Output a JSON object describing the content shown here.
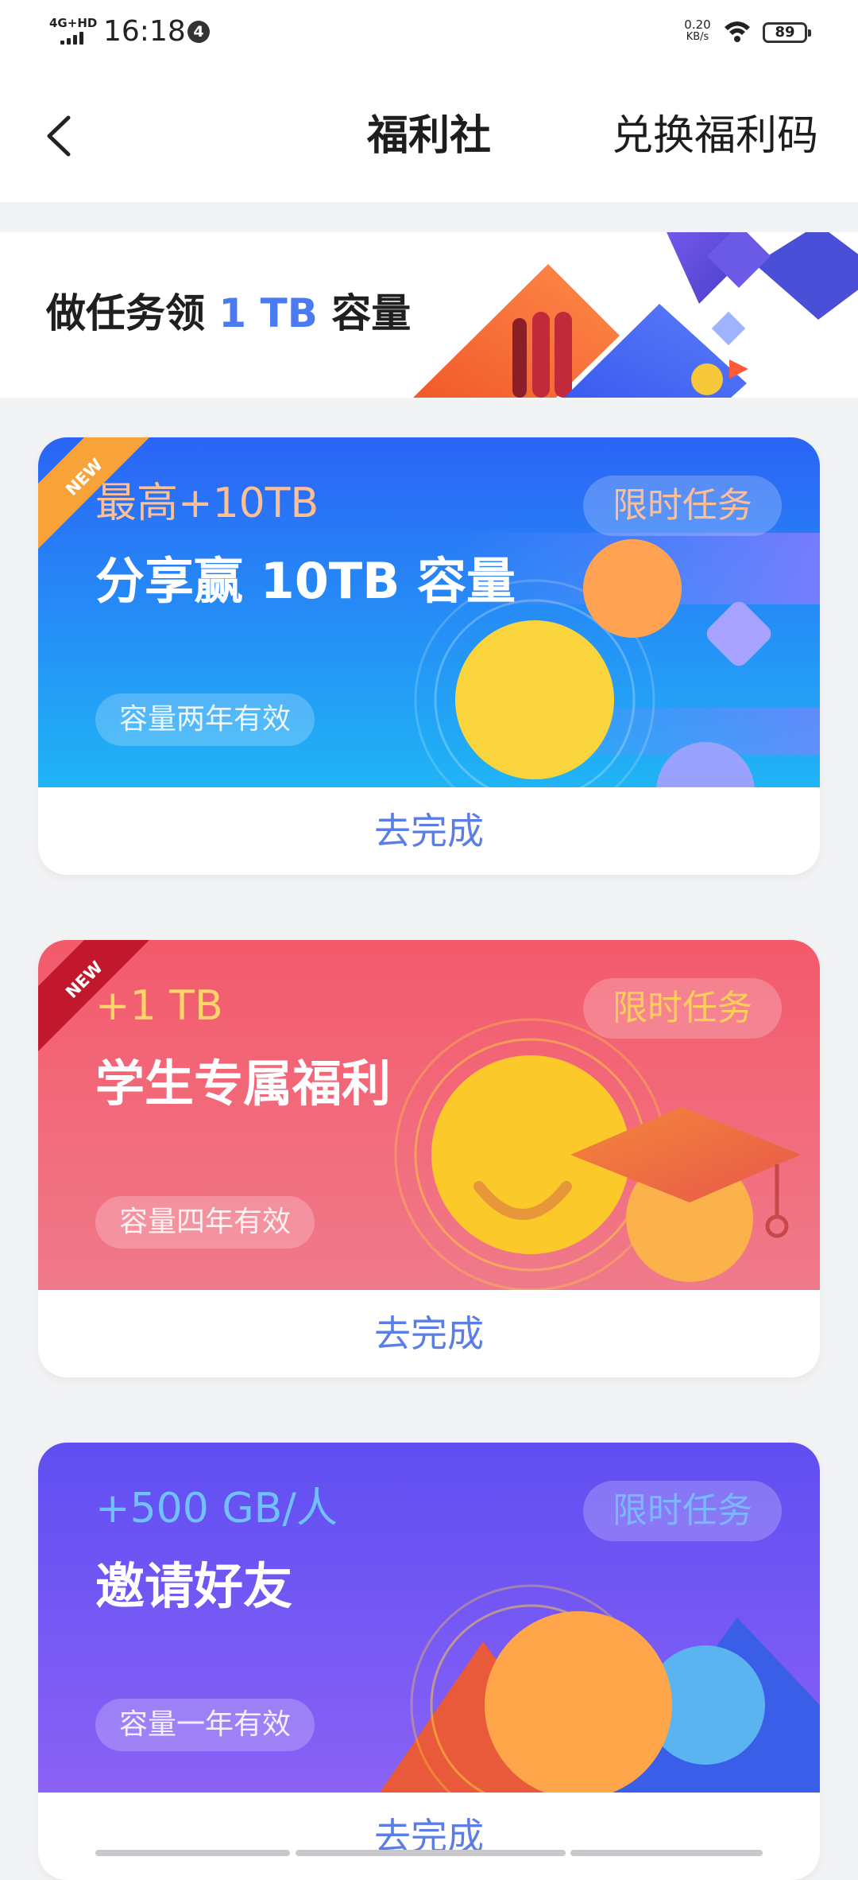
{
  "status_bar": {
    "network": "4G+HD",
    "time": "16:18",
    "notification_count": "4",
    "speed": "0.20",
    "speed_unit": "KB/s",
    "battery": "89"
  },
  "header": {
    "title": "福利社",
    "redeem_label": "兑换福利码",
    "back_icon": "chevron-left-icon"
  },
  "banner": {
    "text_prefix": "做任务领",
    "text_highlight": "1 TB",
    "text_suffix": "容量"
  },
  "colors": {
    "accent": "#4b7bf0",
    "action_text": "#5a7ee6",
    "card1_gradient": [
      "#2d6cf8",
      "#1fb8f5"
    ],
    "card2_gradient": [
      "#f25a6e",
      "#f07c8d"
    ],
    "card3_gradient": [
      "#6450f2",
      "#8a62f5"
    ]
  },
  "cards": [
    {
      "ribbon": "NEW",
      "amount": "最高+10TB",
      "title": "分享赢 10TB 容量",
      "validity": "容量两年有效",
      "tag": "限时任务",
      "action": "去完成"
    },
    {
      "ribbon": "NEW",
      "amount": "+1 TB",
      "title": "学生专属福利",
      "validity": "容量四年有效",
      "tag": "限时任务",
      "action": "去完成"
    },
    {
      "amount": "+500 GB/人",
      "title": "邀请好友",
      "validity": "容量一年有效",
      "tag": "限时任务",
      "action": "去完成"
    }
  ]
}
